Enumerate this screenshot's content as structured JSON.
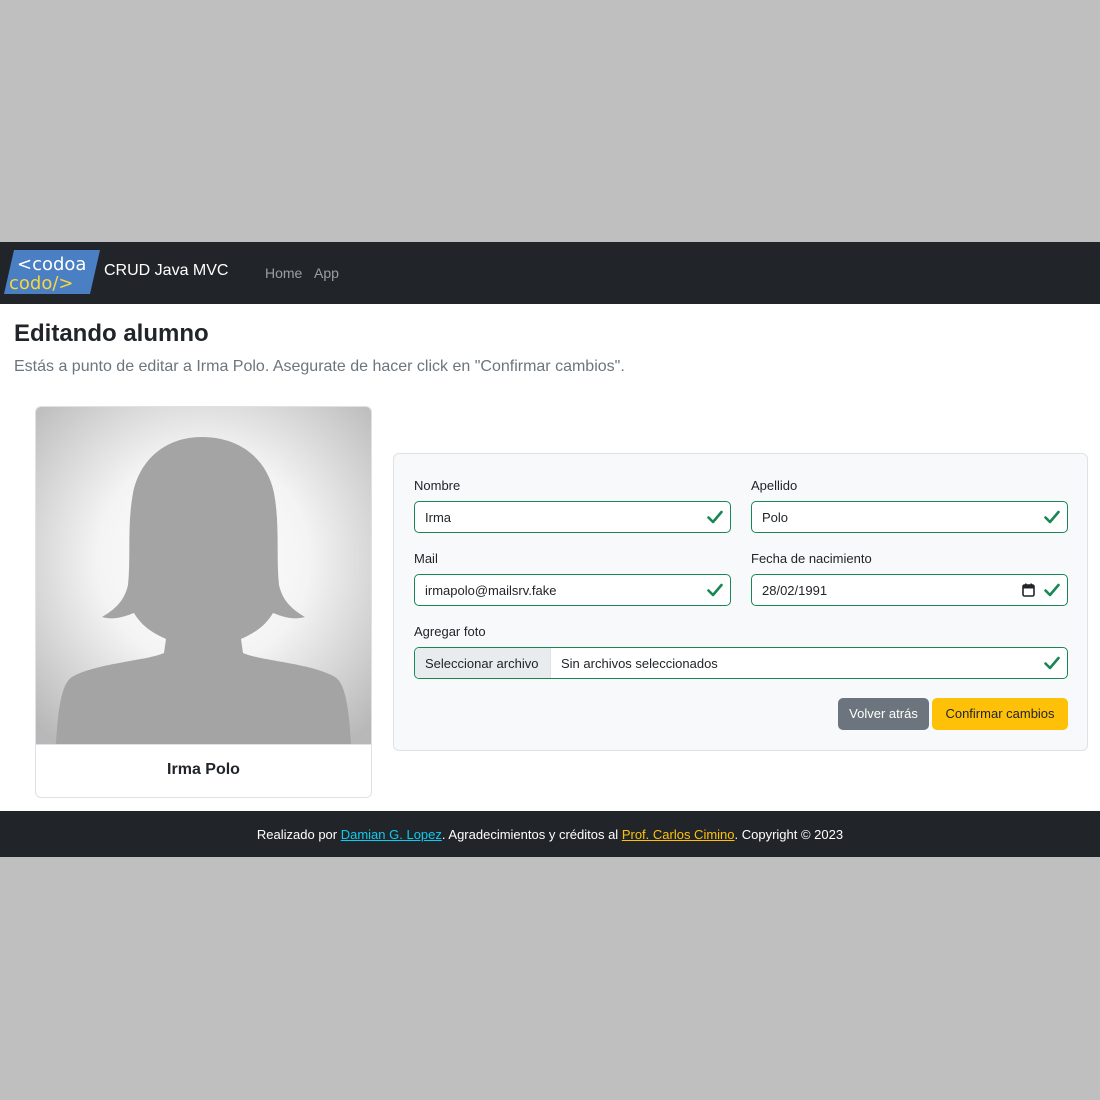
{
  "navbar": {
    "logo_line1": "<codoa",
    "logo_line2": "codo/>",
    "brand": "CRUD Java MVC",
    "links": [
      "Home",
      "App"
    ]
  },
  "page": {
    "title": "Editando alumno",
    "lead": "Estás a punto de editar a Irma Polo. Asegurate de hacer click en \"Confirmar cambios\"."
  },
  "card": {
    "image_icon": "female-silhouette-icon",
    "name": "Irma Polo"
  },
  "form": {
    "nombre_label": "Nombre",
    "nombre_value": "Irma",
    "apellido_label": "Apellido",
    "apellido_value": "Polo",
    "mail_label": "Mail",
    "mail_value": "irmapolo@mailsrv.fake",
    "fecha_label": "Fecha de nacimiento",
    "fecha_value": "28/02/1991",
    "foto_label": "Agregar foto",
    "file_button": "Seleccionar archivo",
    "file_status": "Sin archivos seleccionados",
    "back_button": "Volver atrás",
    "confirm_button": "Confirmar cambios",
    "valid_icon": "check-icon",
    "calendar_icon": "calendar-icon"
  },
  "footer": {
    "prefix": "Realizado por ",
    "author": "Damian G. Lopez",
    "middle": ". Agradecimientos y créditos al ",
    "prof": "Prof. Carlos Cimino",
    "suffix": ". Copyright © 2023"
  },
  "colors": {
    "navbar_bg": "#212529",
    "valid_green": "#198754",
    "secondary": "#6c757d",
    "warning": "#ffc107",
    "info": "#0dcaf0",
    "logo_blue": "#4b7fc4",
    "logo_yellow": "#f5d742"
  }
}
